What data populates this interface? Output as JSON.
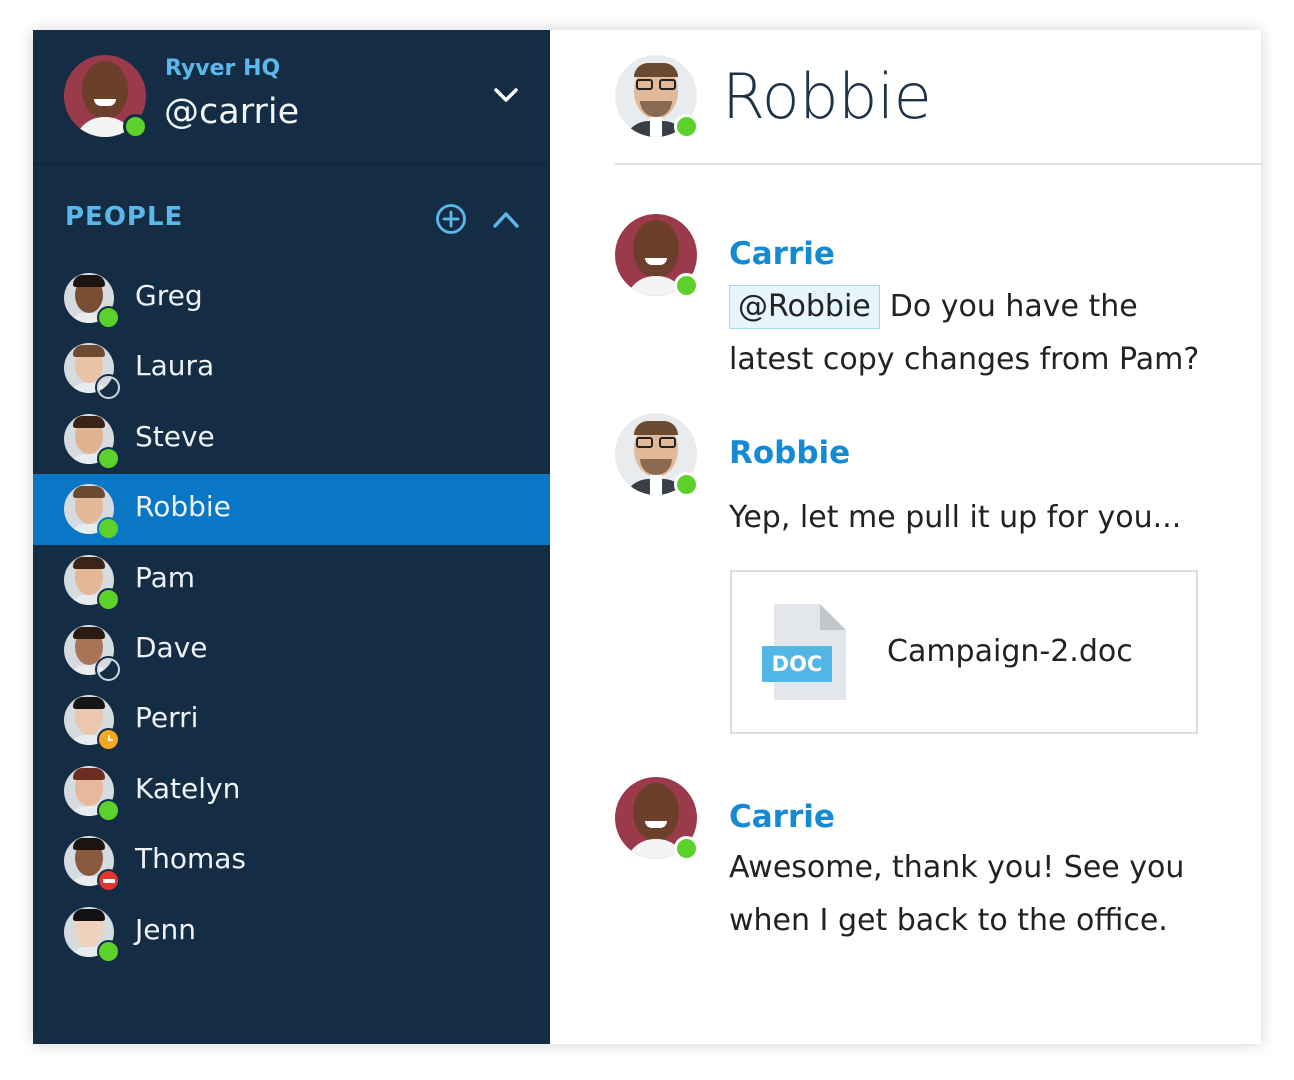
{
  "workspace": {
    "name": "Ryver HQ",
    "handle": "@carrie",
    "status": "online"
  },
  "sidebar": {
    "section_title": "PEOPLE",
    "people": [
      {
        "name": "Greg",
        "status": "online",
        "skin": "#7a4e34",
        "hair": "#1c1410"
      },
      {
        "name": "Laura",
        "status": "away",
        "skin": "#e9c3a6",
        "hair": "#6e4a30"
      },
      {
        "name": "Steve",
        "status": "online",
        "skin": "#e1b491",
        "hair": "#3a2314"
      },
      {
        "name": "Robbie",
        "status": "online",
        "skin": "#e2b999",
        "hair": "#6a4a30",
        "selected": true
      },
      {
        "name": "Pam",
        "status": "online",
        "skin": "#e4b896",
        "hair": "#3b2418"
      },
      {
        "name": "Dave",
        "status": "away",
        "skin": "#a87559",
        "hair": "#2a1a12"
      },
      {
        "name": "Perri",
        "status": "idle",
        "skin": "#ecc7ad",
        "hair": "#151515"
      },
      {
        "name": "Katelyn",
        "status": "online",
        "skin": "#e8b89c",
        "hair": "#6b2e20"
      },
      {
        "name": "Thomas",
        "status": "busy",
        "skin": "#8a5a3e",
        "hair": "#1b1410"
      },
      {
        "name": "Jenn",
        "status": "online",
        "skin": "#efd1bd",
        "hair": "#121212"
      }
    ]
  },
  "chat": {
    "title": "Robbie",
    "messages": [
      {
        "author": "Carrie",
        "mention": "@Robbie",
        "line1": "Do you have the",
        "line2": "latest copy changes from Pam?"
      },
      {
        "author": "Robbie",
        "line1": "Yep, let me pull it up for you...",
        "attachment": {
          "type_label": "DOC",
          "file_name": "Campaign-2.doc"
        }
      },
      {
        "author": "Carrie",
        "line1": "Awesome, thank you! See you",
        "line2": "when I get back to the office."
      }
    ]
  },
  "colors": {
    "sidebar_bg": "#142d45",
    "selected_bg": "#0a76c6",
    "accent": "#1489d4",
    "online": "#5bd12a",
    "idle": "#f5a623",
    "busy": "#e0362c"
  }
}
